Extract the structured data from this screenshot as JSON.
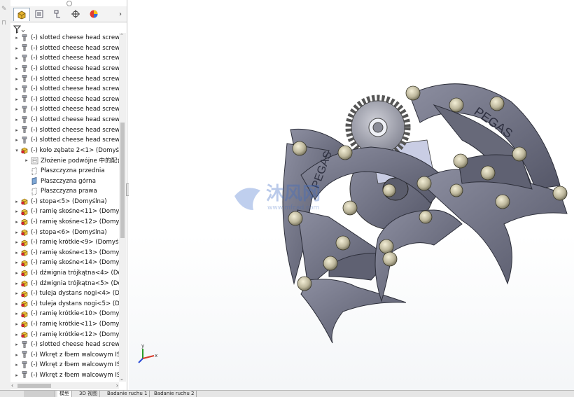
{
  "tree": {
    "rows": [
      {
        "indent": 0,
        "exp": "▸",
        "icon": "screw",
        "label": "(-) slotted cheese head screw_is"
      },
      {
        "indent": 0,
        "exp": "▸",
        "icon": "screw",
        "label": "(-) slotted cheese head screw_is"
      },
      {
        "indent": 0,
        "exp": "▸",
        "icon": "screw",
        "label": "(-) slotted cheese head screw_is"
      },
      {
        "indent": 0,
        "exp": "▸",
        "icon": "screw",
        "label": "(-) slotted cheese head screw_is"
      },
      {
        "indent": 0,
        "exp": "▸",
        "icon": "screw",
        "label": "(-) slotted cheese head screw_is"
      },
      {
        "indent": 0,
        "exp": "▸",
        "icon": "screw",
        "label": "(-) slotted cheese head screw_is"
      },
      {
        "indent": 0,
        "exp": "▸",
        "icon": "screw",
        "label": "(-) slotted cheese head screw_is"
      },
      {
        "indent": 0,
        "exp": "▸",
        "icon": "screw",
        "label": "(-) slotted cheese head screw_is"
      },
      {
        "indent": 0,
        "exp": "▸",
        "icon": "screw",
        "label": "(-) slotted cheese head screw_is"
      },
      {
        "indent": 0,
        "exp": "▸",
        "icon": "screw",
        "label": "(-) slotted cheese head screw_is"
      },
      {
        "indent": 0,
        "exp": "▸",
        "icon": "screw",
        "label": "(-) slotted cheese head screw_is"
      },
      {
        "indent": 0,
        "exp": "▾",
        "icon": "part",
        "label": "(-) koło zębate 2<1> (Domyślna"
      },
      {
        "indent": 1,
        "exp": "▸",
        "icon": "mate",
        "label": "Złożenie podwójne 中的配合"
      },
      {
        "indent": 1,
        "exp": "",
        "icon": "plane",
        "label": "Płaszczyzna przednia"
      },
      {
        "indent": 1,
        "exp": "",
        "icon": "plane-blue",
        "label": "Płaszczyzna górna"
      },
      {
        "indent": 1,
        "exp": "",
        "icon": "plane",
        "label": "Płaszczyzna prawa"
      },
      {
        "indent": 0,
        "exp": "▸",
        "icon": "part",
        "label": "(-) stopa<5> (Domyślna)"
      },
      {
        "indent": 0,
        "exp": "▸",
        "icon": "part",
        "label": "(-) ramię skośne<11> (Domyśln"
      },
      {
        "indent": 0,
        "exp": "▸",
        "icon": "part",
        "label": "(-) ramię skośne<12> (Domyśln"
      },
      {
        "indent": 0,
        "exp": "▸",
        "icon": "part",
        "label": "(-) stopa<6> (Domyślna)"
      },
      {
        "indent": 0,
        "exp": "▸",
        "icon": "part",
        "label": "(-) ramię krótkie<9> (Domyślna"
      },
      {
        "indent": 0,
        "exp": "▸",
        "icon": "part",
        "label": "(-) ramię skośne<13> (Domyśln"
      },
      {
        "indent": 0,
        "exp": "▸",
        "icon": "part",
        "label": "(-) ramię skośne<14> (Domyśln"
      },
      {
        "indent": 0,
        "exp": "▸",
        "icon": "part",
        "label": "(-) dźwignia trójkątna<4> (Dom"
      },
      {
        "indent": 0,
        "exp": "▸",
        "icon": "part",
        "label": "(-) dźwignia trójkątna<5> (Dom"
      },
      {
        "indent": 0,
        "exp": "▸",
        "icon": "part",
        "label": "(-) tuleja dystans nogi<4> (Dom"
      },
      {
        "indent": 0,
        "exp": "▸",
        "icon": "part",
        "label": "(-) tuleja dystans nogi<5> (Dom"
      },
      {
        "indent": 0,
        "exp": "▸",
        "icon": "part",
        "label": "(-) ramię krótkie<10> (Domyśln"
      },
      {
        "indent": 0,
        "exp": "▸",
        "icon": "part",
        "label": "(-) ramię krótkie<11> (Domyśln"
      },
      {
        "indent": 0,
        "exp": "▸",
        "icon": "part",
        "label": "(-) ramię krótkie<12> (Domyśln"
      },
      {
        "indent": 0,
        "exp": "▸",
        "icon": "screw",
        "label": "(-) slotted cheese head screw_is"
      },
      {
        "indent": 0,
        "exp": "▸",
        "icon": "screw",
        "label": "(-) Wkręt z łbem walcowym ISO"
      },
      {
        "indent": 0,
        "exp": "▸",
        "icon": "screw",
        "label": "(-) Wkręt z łbem walcowym ISO"
      },
      {
        "indent": 0,
        "exp": "▸",
        "icon": "screw",
        "label": "(-) Wkręt z łbem walcowym ISO"
      }
    ]
  },
  "model": {
    "engraving_left": "PEGAS",
    "engraving_right": "PEGAS",
    "watermark_text": "沐风网",
    "watermark_url": "www.mfcad.com"
  },
  "bottom_tabs": {
    "model": "模型",
    "view3d": "3D 视图",
    "motion1": "Badanie ruchu 1",
    "motion2": "Badanie ruchu 2"
  },
  "colors": {
    "metal": "#6d6f80",
    "metal_light": "#9a9cab",
    "accent_blue": "#3d6bc4"
  }
}
